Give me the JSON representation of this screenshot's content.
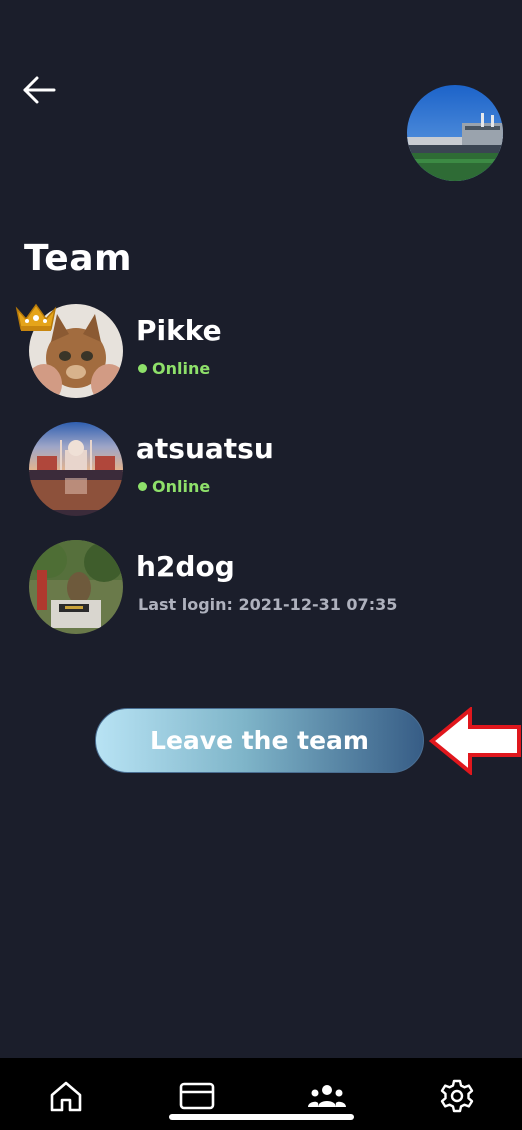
{
  "header": {
    "back_icon": "arrow-left-icon",
    "profile_avatar": "stadium-photo"
  },
  "title": "Team",
  "members": [
    {
      "name": "Pikke",
      "status": "Online",
      "online": true,
      "leader": true,
      "avatar": "cat-photo"
    },
    {
      "name": "atsuatsu",
      "status": "Online",
      "online": true,
      "leader": false,
      "avatar": "taj-mahal-photo"
    },
    {
      "name": "h2dog",
      "status": "Last login: 2021-12-31 07:35",
      "online": false,
      "leader": false,
      "avatar": "dog-statue-photo"
    }
  ],
  "leave_button": {
    "label": "Leave the team"
  },
  "annotation": {
    "arrow_color": "#e0171d",
    "pointing_at": "leave-team-button"
  },
  "colors": {
    "background": "#1b1e2b",
    "online": "#8ee06a",
    "nav_bar": "#000000"
  },
  "bottom_nav": [
    {
      "icon": "home-icon"
    },
    {
      "icon": "card-icon"
    },
    {
      "icon": "team-icon"
    },
    {
      "icon": "gear-icon"
    }
  ]
}
